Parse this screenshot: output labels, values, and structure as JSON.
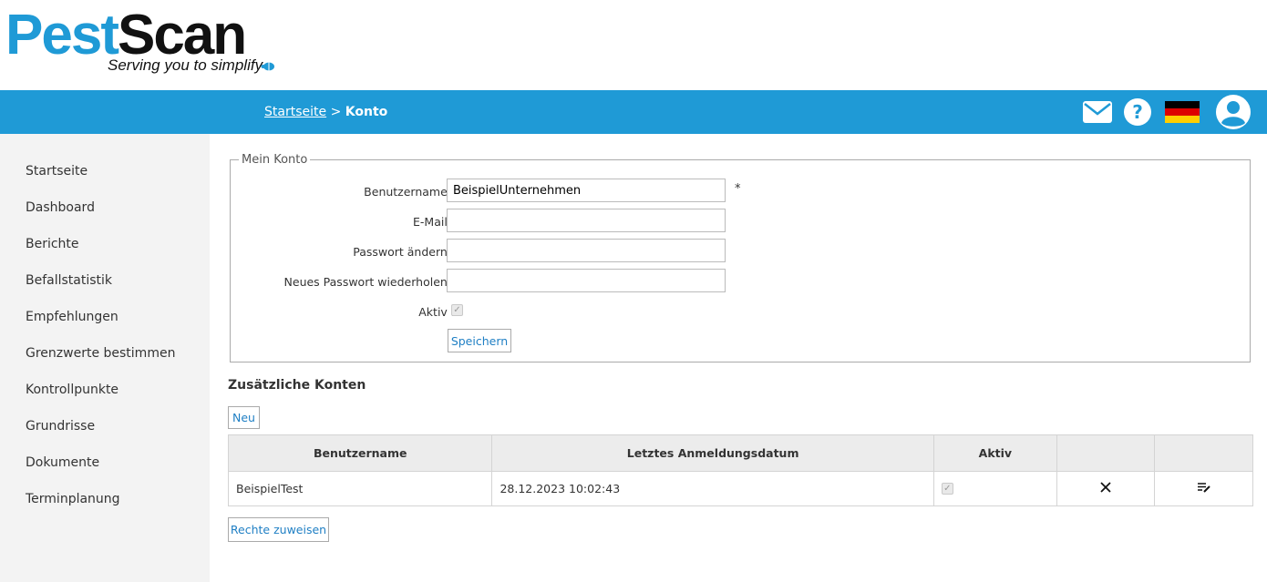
{
  "logo": {
    "brand_part1": "Pest",
    "brand_part2": "Scan",
    "tagline": "Serving you to simplify"
  },
  "breadcrumb": {
    "home": "Startseite",
    "separator": ">",
    "current": "Konto"
  },
  "header_icons": [
    "mail-icon",
    "help-icon",
    "german-flag-icon",
    "user-avatar-icon"
  ],
  "colors": {
    "brand_blue": "#1f9ad6",
    "link_blue": "#1f7fc4"
  },
  "sidebar": {
    "items": [
      {
        "label": "Startseite"
      },
      {
        "label": "Dashboard"
      },
      {
        "label": "Berichte"
      },
      {
        "label": "Befallstatistik"
      },
      {
        "label": "Empfehlungen"
      },
      {
        "label": "Grenzwerte bestimmen"
      },
      {
        "label": "Kontrollpunkte"
      },
      {
        "label": "Grundrisse"
      },
      {
        "label": "Dokumente"
      },
      {
        "label": "Terminplanung"
      }
    ]
  },
  "account": {
    "legend": "Mein Konto",
    "username_label": "Benutzername :",
    "username_value": "BeispielUnternehmen",
    "required_marker": "*",
    "email_label": "E-Mail :",
    "email_value": "",
    "password_label": "Passwort ändern :",
    "password_value": "",
    "password_repeat_label": "Neues Passwort wiederholen :",
    "password_repeat_value": "",
    "active_label": "Aktiv :",
    "active_checked": true,
    "save_label": "Speichern"
  },
  "extra_accounts": {
    "title": "Zusätzliche Konten",
    "new_label": "Neu",
    "columns": [
      "Benutzername",
      "Letztes Anmeldungsdatum",
      "Aktiv",
      "",
      ""
    ],
    "rows": [
      {
        "username": "BeispielTest",
        "last_login": "28.12.2023 10:02:43",
        "active": true,
        "delete_icon": "close-icon",
        "edit_icon": "edit-list-icon"
      }
    ],
    "rights_label": "Rechte zuweisen"
  }
}
